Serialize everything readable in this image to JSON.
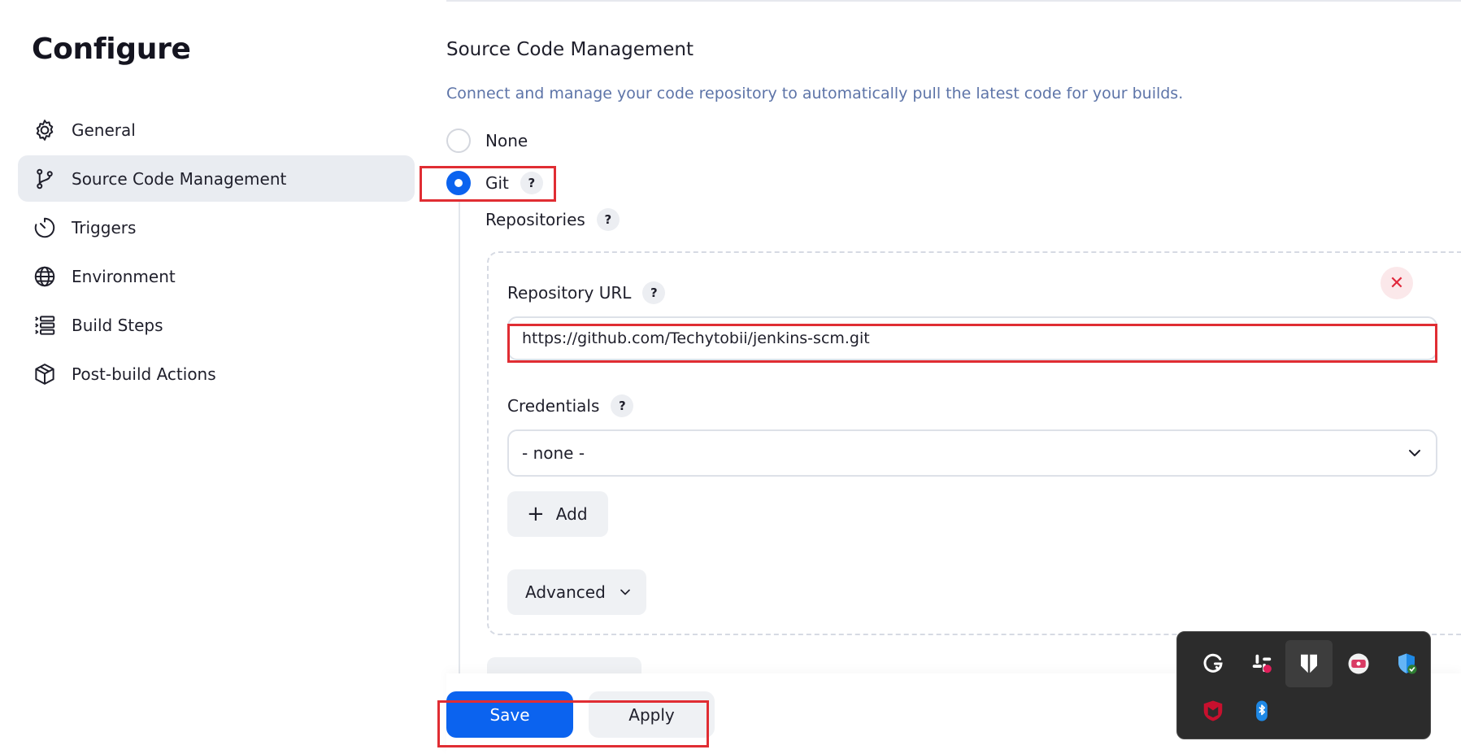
{
  "page": {
    "title": "Configure"
  },
  "sidebar": {
    "items": [
      {
        "label": "General",
        "icon": "gear-icon"
      },
      {
        "label": "Source Code Management",
        "icon": "git-branch-icon",
        "active": true
      },
      {
        "label": "Triggers",
        "icon": "timer-icon"
      },
      {
        "label": "Environment",
        "icon": "globe-icon"
      },
      {
        "label": "Build Steps",
        "icon": "list-steps-icon"
      },
      {
        "label": "Post-build Actions",
        "icon": "package-icon"
      }
    ]
  },
  "scm": {
    "title": "Source Code Management",
    "description": "Connect and manage your code repository to automatically pull the latest code for your builds.",
    "options": [
      {
        "label": "None",
        "selected": false
      },
      {
        "label": "Git",
        "selected": true,
        "help": "?"
      }
    ],
    "repositories": {
      "label": "Repositories",
      "help": "?",
      "remove_icon": "close-icon",
      "url": {
        "label": "Repository URL",
        "help": "?",
        "value": "https://github.com/Techytobii/jenkins-scm.git"
      },
      "credentials": {
        "label": "Credentials",
        "help": "?",
        "selected": "- none -"
      },
      "add_label": "Add",
      "advanced_label": "Advanced"
    }
  },
  "actions": {
    "save_label": "Save",
    "apply_label": "Apply"
  },
  "tray": {
    "icons": [
      "grammarly-icon",
      "slack-icon",
      "snipping-tool-icon",
      "screen-recorder-icon",
      "security-shield-icon",
      "mcafee-icon",
      "bluetooth-icon"
    ]
  },
  "colors": {
    "accent": "#0b63ef",
    "highlight": "#e02d33",
    "description": "#5d74a8",
    "remove": "#e0283c",
    "tray_bg": "#2c2c2c"
  }
}
